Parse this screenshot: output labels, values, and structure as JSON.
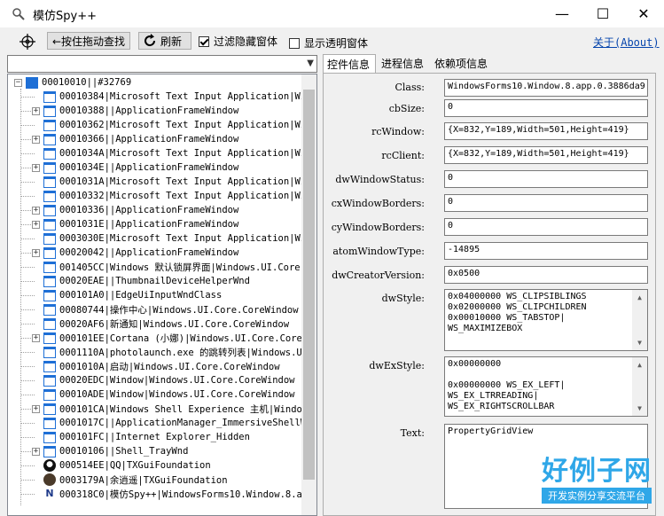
{
  "window": {
    "title": "模仿Spy++",
    "minimize": "—",
    "maximize": "☐",
    "close": "✕"
  },
  "toolbar": {
    "drag_find_label": "←按住拖动查找",
    "refresh_label": "刷新",
    "filter_hidden_label": "过滤隐藏窗体",
    "filter_hidden_checked": true,
    "show_transparent_label": "显示透明窗体",
    "show_transparent_checked": false,
    "about_label": "关于(About)"
  },
  "tree": {
    "root": "00010010||#32769",
    "items": [
      {
        "text": "00010384|Microsoft Text Input Application|Wi",
        "expand": false
      },
      {
        "text": "00010388||ApplicationFrameWindow",
        "expand": true
      },
      {
        "text": "00010362|Microsoft Text Input Application|Wi",
        "expand": false
      },
      {
        "text": "00010366||ApplicationFrameWindow",
        "expand": true
      },
      {
        "text": "0001034A|Microsoft Text Input Application|Wi",
        "expand": false
      },
      {
        "text": "0001034E||ApplicationFrameWindow",
        "expand": true
      },
      {
        "text": "0001031A|Microsoft Text Input Application|Wi",
        "expand": false
      },
      {
        "text": "00010332|Microsoft Text Input Application|Wi",
        "expand": false
      },
      {
        "text": "00010336||ApplicationFrameWindow",
        "expand": true
      },
      {
        "text": "0001031E||ApplicationFrameWindow",
        "expand": true
      },
      {
        "text": "0003030E|Microsoft Text Input Application|Wi",
        "expand": false
      },
      {
        "text": "00020042||ApplicationFrameWindow",
        "expand": true
      },
      {
        "text": "001405CC|Windows 默认锁屏界面|Windows.UI.Core",
        "expand": false
      },
      {
        "text": "00020EAE||ThumbnailDeviceHelperWnd",
        "expand": false
      },
      {
        "text": "000101A0||EdgeUiInputWndClass",
        "expand": false
      },
      {
        "text": "00080744|操作中心|Windows.UI.Core.CoreWindow",
        "expand": false
      },
      {
        "text": "00020AF6|新通知|Windows.UI.Core.CoreWindow",
        "expand": false
      },
      {
        "text": "000101EE|Cortana (小娜)|Windows.UI.Core.CoreW",
        "expand": true
      },
      {
        "text": "0001110A|photolaunch.exe 的跳转列表|Windows.U",
        "expand": false
      },
      {
        "text": "0001010A|启动|Windows.UI.Core.CoreWindow",
        "expand": false
      },
      {
        "text": "00020EDC|Window|Windows.UI.Core.CoreWindow",
        "expand": false
      },
      {
        "text": "00010ADE|Window|Windows.UI.Core.CoreWindow",
        "expand": false
      },
      {
        "text": "000101CA|Windows Shell Experience 主机|Window",
        "expand": true
      },
      {
        "text": "0001017C||ApplicationManager_ImmersiveShellWi",
        "expand": false
      },
      {
        "text": "000101FC||Internet Explorer_Hidden",
        "expand": false
      },
      {
        "text": "00010106||Shell_TrayWnd",
        "expand": true
      },
      {
        "text": "000514EE|QQ|TXGuiFoundation",
        "expand": false,
        "icon": "qq"
      },
      {
        "text": "0003179A|余逍遥|TXGuiFoundation",
        "expand": false,
        "icon": "avatar"
      },
      {
        "text": "000318C0|模仿Spy++|WindowsForms10.Window.8.a",
        "expand": false,
        "icon": "n"
      }
    ]
  },
  "tabs": [
    {
      "label": "控件信息",
      "active": true
    },
    {
      "label": "进程信息",
      "active": false
    },
    {
      "label": "依赖项信息",
      "active": false
    }
  ],
  "props": {
    "class_label": "Class:",
    "class_value": "WindowsForms10.Window.8.app.0.3886da9",
    "cbsize_label": "cbSize:",
    "cbsize_value": "0",
    "rcwindow_label": "rcWindow:",
    "rcwindow_value": "{X=832,Y=189,Width=501,Height=419}",
    "rcclient_label": "rcClient:",
    "rcclient_value": "{X=832,Y=189,Width=501,Height=419}",
    "dwwindowstatus_label": "dwWindowStatus:",
    "dwwindowstatus_value": "0",
    "cxwindowborders_label": "cxWindowBorders:",
    "cxwindowborders_value": "0",
    "cywindowborders_label": "cyWindowBorders:",
    "cywindowborders_value": "0",
    "atomwindowtype_label": "atomWindowType:",
    "atomwindowtype_value": "-14895",
    "dwcreatorversion_label": "dwCreatorVersion:",
    "dwcreatorversion_value": "0x0500",
    "dwstyle_label": "dwStyle:",
    "dwstyle_lines": [
      "0x04000000 WS_CLIPSIBLINGS",
      "0x02000000 WS_CLIPCHILDREN",
      "0x00010000 WS_TABSTOP|",
      "WS_MAXIMIZEBOX"
    ],
    "dwexstyle_label": "dwExStyle:",
    "dwexstyle_lines": [
      "0x00000000",
      "",
      "0x00000000 WS_EX_LEFT|",
      "WS_EX_LTRREADING|",
      "WS_EX_RIGHTSCROLLBAR"
    ],
    "text_label": "Text:",
    "text_value": "PropertyGridView"
  },
  "watermark": {
    "main": "好例子网",
    "sub": "开发实例分享交流平台"
  }
}
